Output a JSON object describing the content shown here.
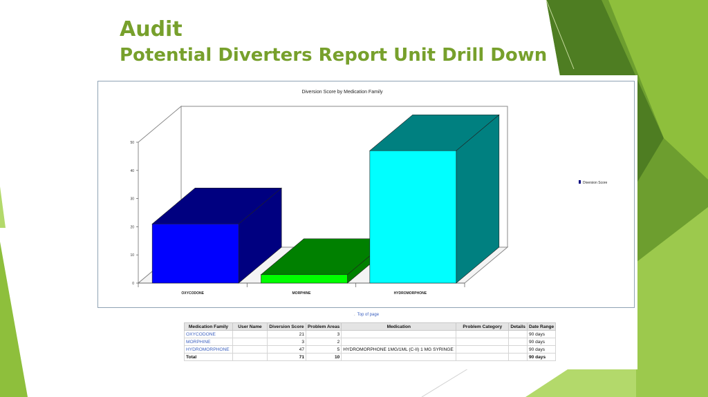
{
  "slide": {
    "title": "Audit",
    "subtitle": "Potential Diverters Report Unit Drill Down"
  },
  "chart_data": {
    "type": "bar",
    "title": "Diversion Score by Medication Family",
    "categories": [
      "OXYCODONE",
      "MORPHINE",
      "HYDROMORPHONE"
    ],
    "series": [
      {
        "name": "Diversion Score",
        "values": [
          21,
          3,
          47
        ]
      }
    ],
    "bar_colors": [
      "#0000ff",
      "#00ff00",
      "#00ffff"
    ],
    "bar_side_colors": [
      "#000080",
      "#008000",
      "#008080"
    ],
    "ylim": [
      0,
      50
    ],
    "yticks": [
      0,
      10,
      20,
      30,
      40,
      50
    ],
    "legend_position": "right",
    "three_d": true,
    "xlabel": "",
    "ylabel": ""
  },
  "top_of_page_link": "Top of page",
  "table": {
    "headers": [
      "Medication Family",
      "User Name",
      "Diversion Score",
      "Problem Areas",
      "Medication",
      "Problem Category",
      "Details",
      "Date Range"
    ],
    "rows": [
      [
        "OXYCODONE",
        "",
        "21",
        "3",
        "",
        "",
        "",
        "90 days"
      ],
      [
        "MORPHINE",
        "",
        "3",
        "2",
        "",
        "",
        "",
        "90 days"
      ],
      [
        "HYDROMORPHONE",
        "",
        "47",
        "5",
        "HYDROMORPHONE 1MG/1ML (C-II) 1 MG SYRINGE",
        "",
        "",
        "90 days"
      ],
      [
        "Total",
        "",
        "71",
        "10",
        "",
        "",
        "",
        "90 days"
      ]
    ]
  },
  "colors": {
    "title": "#77a02c",
    "green_dark": "#4e7d22",
    "green_mid": "#77a83a",
    "green_light": "#9cc94d",
    "link": "#3a5fbf"
  }
}
